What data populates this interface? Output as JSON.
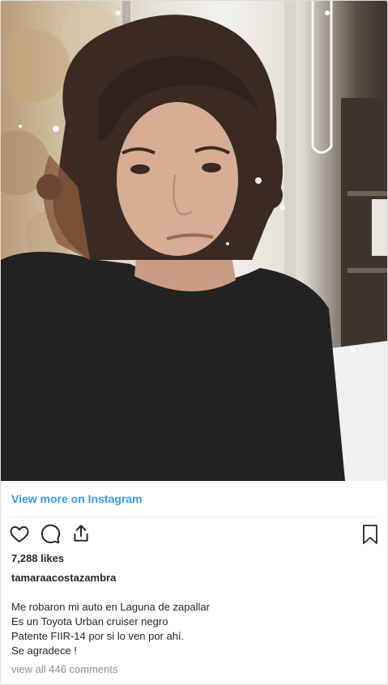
{
  "post": {
    "image_alt": "Photo of a woman with curly dark hair wearing a black sweater",
    "view_more_label": "View more on Instagram",
    "likes": "7,288 likes",
    "username": "tamaraacostazambra",
    "caption_lines": [
      "Me robaron mi auto en Laguna de zapallar",
      "Es un Toyota Urban cruiser negro",
      "Patente FIIR-14 por si lo ven por ahí.",
      "Se agradece !"
    ],
    "comments_link": "view all 446 comments"
  },
  "icons": {
    "like": "heart-icon",
    "comment": "comment-icon",
    "share": "share-icon",
    "save": "bookmark-icon"
  },
  "colors": {
    "link": "#3897f0",
    "text": "#262626",
    "muted": "#8e8e8e",
    "border": "#dbdbdb"
  }
}
